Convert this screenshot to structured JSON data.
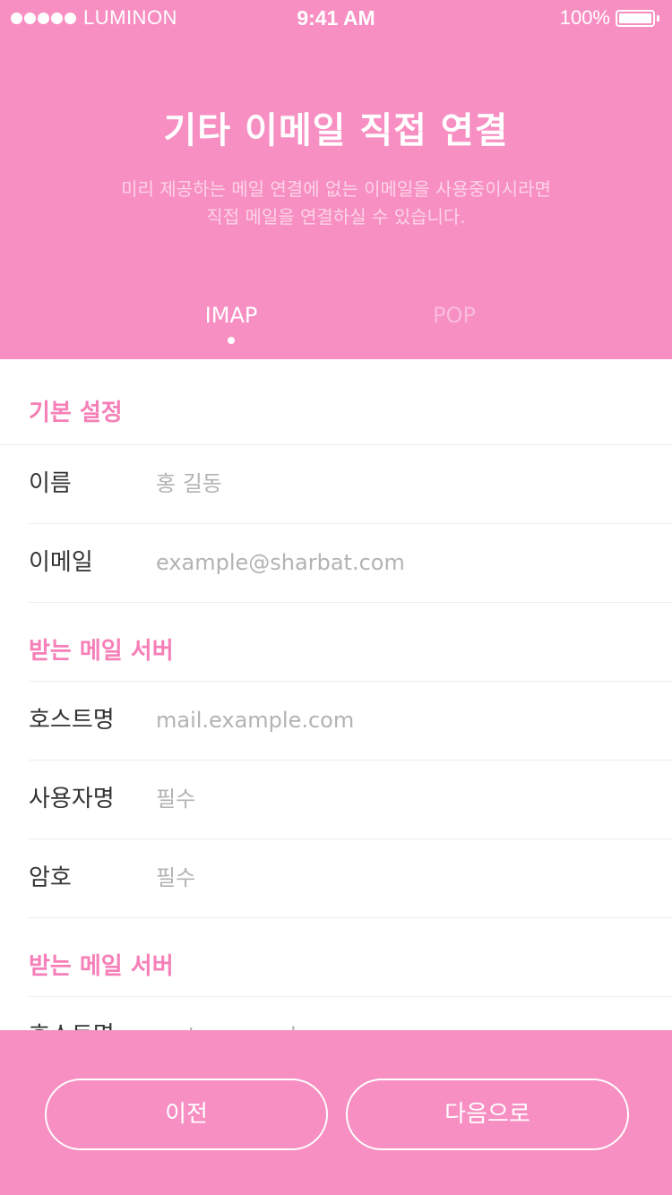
{
  "status": {
    "carrier": "LUMINON",
    "time": "9:41 AM",
    "battery": "100%",
    "battery_level": 1.0
  },
  "header": {
    "title": "기타 이메일 직접 연결",
    "subtitle_line1": "미리 제공하는 메일 연결에 없는 이메일을 사용중이시라면",
    "subtitle_line2": "직접 메일을 연결하실 수 있습니다.",
    "tabs": [
      {
        "label": "IMAP",
        "active": true
      },
      {
        "label": "POP",
        "active": false
      }
    ]
  },
  "form": {
    "basic": {
      "title": "기본 설정",
      "name_label": "이름",
      "name_placeholder": "홍 길동",
      "email_label": "이메일",
      "email_placeholder": "example@sharbat.com"
    },
    "incoming": {
      "title": "받는 메일 서버",
      "host_label": "호스트명",
      "host_placeholder": "mail.example.com",
      "user_label": "사용자명",
      "user_placeholder": "필수",
      "password_label": "암호",
      "password_placeholder": "필수"
    },
    "outgoing": {
      "title": "받는 메일 서버",
      "host_label": "호스트명",
      "host_placeholder": "smtp.example.com"
    }
  },
  "footer": {
    "prev_label": "이전",
    "next_label": "다음으로"
  },
  "colors": {
    "accent": "#f78fc2",
    "section_title": "#f67fb8",
    "divider": "#ececec",
    "placeholder": "#b3b3b3"
  }
}
